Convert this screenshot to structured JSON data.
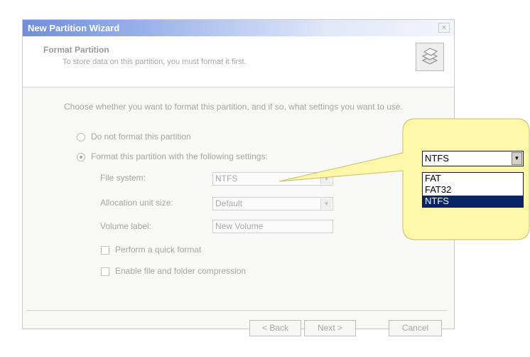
{
  "dialog": {
    "title": "New Partition Wizard",
    "close": "×",
    "header_title": "Format Partition",
    "header_subtitle": "To store data on this partition, you must format it first.",
    "header_icon": "disk-stack-icon",
    "prompt": "Choose whether you want to format this partition, and if so, what settings you want to use.",
    "option_no_format": "Do not format this partition",
    "option_format": "Format this partition with the following settings:",
    "file_system_label": "File system:",
    "file_system_value": "NTFS",
    "alloc_label": "Allocation unit size:",
    "alloc_value": "Default",
    "volume_label": "Volume label:",
    "volume_value": "New Volume",
    "quick_format": "Perform a quick format",
    "compression": "Enable file and folder compression",
    "back": "< Back",
    "next": "Next >",
    "cancel": "Cancel"
  },
  "callout": {
    "selected": "NTFS",
    "options": [
      "FAT",
      "FAT32",
      "NTFS"
    ],
    "highlight_color": "#0a246a",
    "bubble_color": "#fef7a8"
  }
}
